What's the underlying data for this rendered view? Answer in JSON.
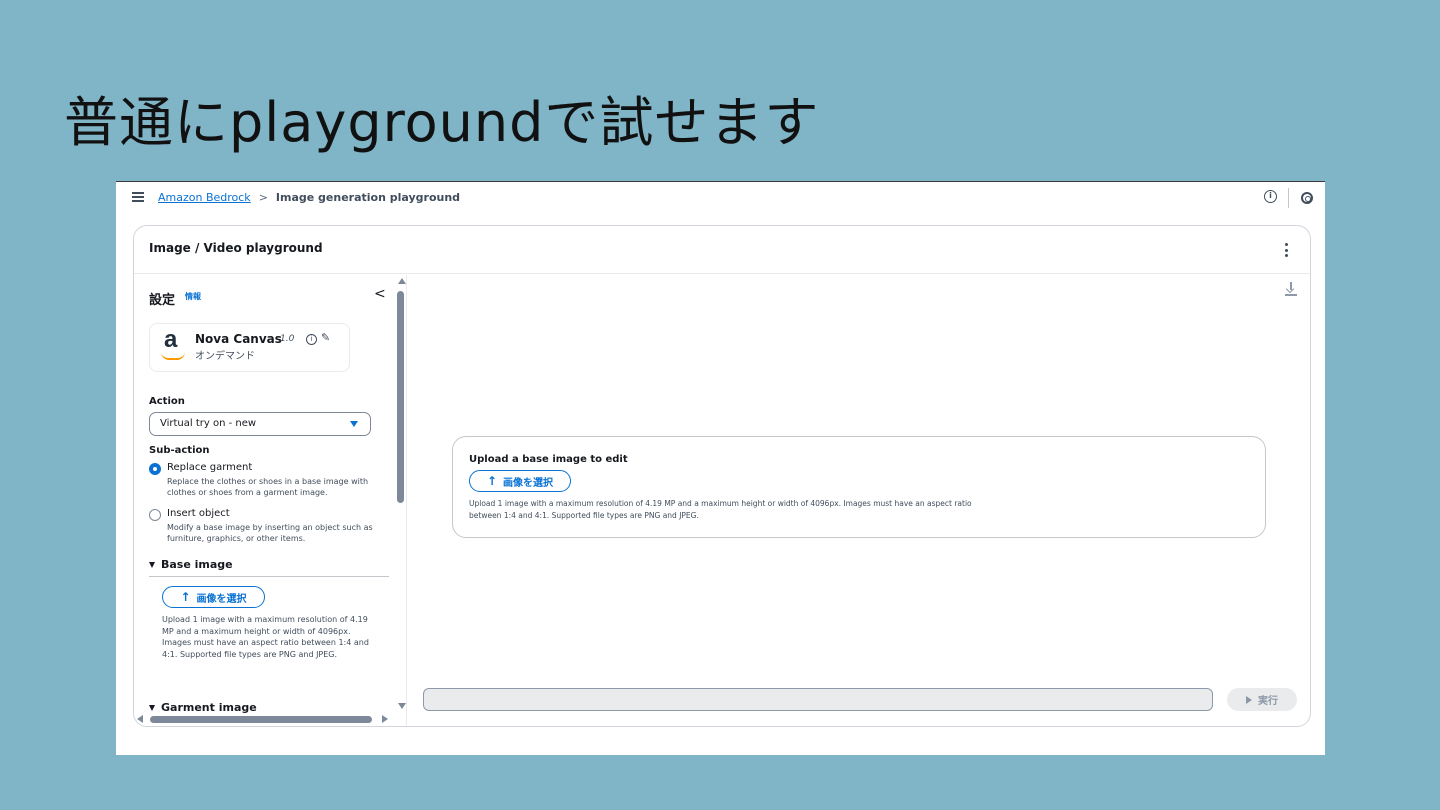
{
  "slide": {
    "title": "普通にplaygroundで試せます"
  },
  "colors": {
    "accent": "#0972d3",
    "background": "#80b5c8",
    "text": "#16191f"
  },
  "breadcrumb": {
    "root": "Amazon Bedrock",
    "separator": ">",
    "current": "Image generation playground"
  },
  "header_icons": [
    "info-icon",
    "settings-icon"
  ],
  "card": {
    "title": "Image / Video playground"
  },
  "settings": {
    "heading": "設定",
    "info_link": "情報",
    "collapse": "<"
  },
  "model": {
    "logo_letter": "a",
    "name": "Nova Canvas",
    "version": "1.0",
    "mode": "オンデマンド"
  },
  "action": {
    "label": "Action",
    "selected": "Virtual try on - new"
  },
  "subaction": {
    "label": "Sub-action",
    "options": [
      {
        "title": "Replace garment",
        "description": "Replace the clothes or shoes in a base image with clothes or shoes from a garment image.",
        "checked": true
      },
      {
        "title": "Insert object",
        "description": "Modify a base image by inserting an object such as furniture, graphics, or other items.",
        "checked": false
      }
    ]
  },
  "base_image": {
    "header": "Base image",
    "button": "画像を選択",
    "description": "Upload 1 image with a maximum resolution of 4.19 MP and a maximum height or width of 4096px. Images must have an aspect ratio between 1:4 and 4:1. Supported file types are PNG and JPEG."
  },
  "garment_image": {
    "header": "Garment image"
  },
  "upload_box": {
    "title": "Upload a base image to edit",
    "button": "画像を選択",
    "description": "Upload 1 image with a maximum resolution of 4.19 MP and a maximum height or width of 4096px. Images must have an aspect ratio between 1:4 and 4:1. Supported file types are PNG and JPEG."
  },
  "prompt": {
    "value": ""
  },
  "run_button": {
    "label": "実行"
  }
}
